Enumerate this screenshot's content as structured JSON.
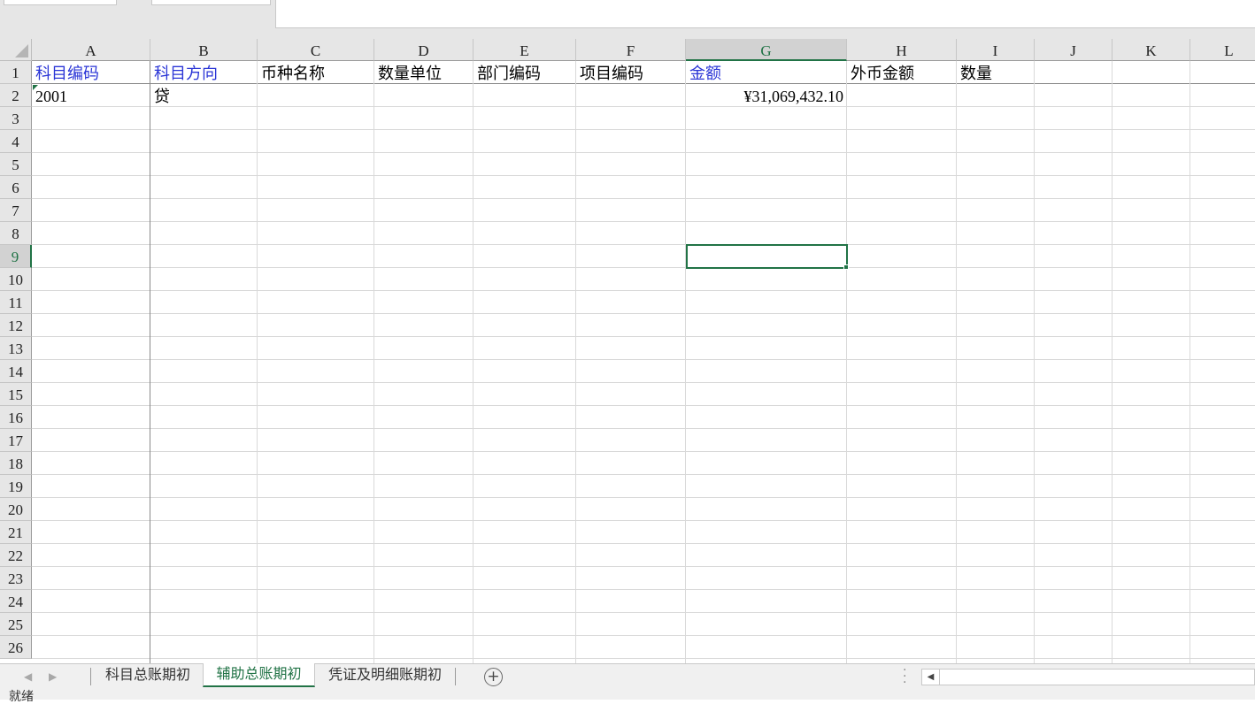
{
  "columns": [
    "A",
    "B",
    "C",
    "D",
    "E",
    "F",
    "G",
    "H",
    "I",
    "J",
    "K",
    "L"
  ],
  "active_column": "G",
  "rows": [
    "1",
    "2",
    "3",
    "4",
    "5",
    "6",
    "7",
    "8",
    "9",
    "10",
    "11",
    "12",
    "13",
    "14",
    "15",
    "16",
    "17",
    "18",
    "19",
    "20",
    "21",
    "22",
    "23",
    "24",
    "25",
    "26"
  ],
  "active_row": "9",
  "header_row": {
    "A": "科目编码",
    "B": "科目方向",
    "C": "币种名称",
    "D": "数量单位",
    "E": "部门编码",
    "F": "项目编码",
    "G": "金额",
    "H": "外币金额",
    "I": "数量"
  },
  "data_row": {
    "A": "2001",
    "B": "贷",
    "G": "¥31,069,432.10"
  },
  "sheet_tabs": [
    {
      "label": "科目总账期初",
      "active": false
    },
    {
      "label": "辅助总账期初",
      "active": true
    },
    {
      "label": "凭证及明细账期初",
      "active": false
    }
  ],
  "add_sheet_label": "+",
  "status_text": "就绪",
  "colors": {
    "accent_green": "#217346",
    "header_blue_text": "#2a35d6"
  }
}
